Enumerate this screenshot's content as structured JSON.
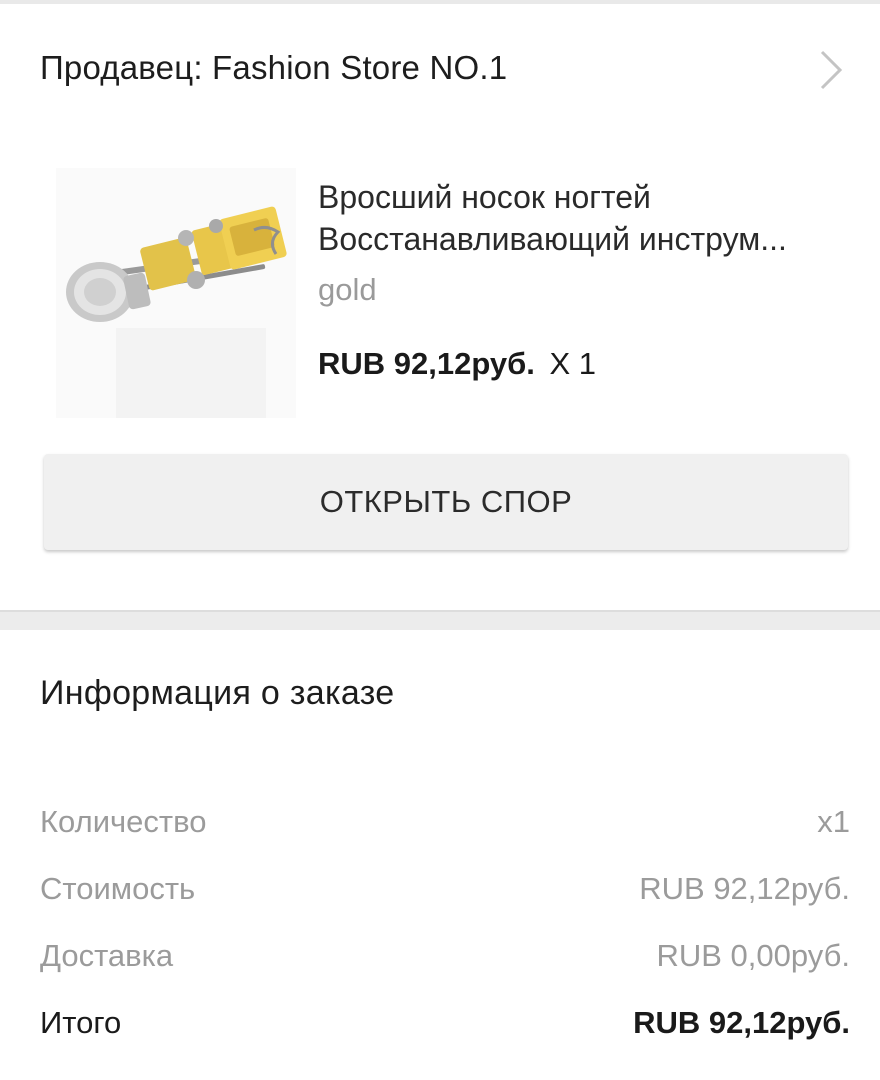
{
  "seller": {
    "label": "Продавец: Fashion Store NO.1"
  },
  "product": {
    "title_line1": "Вросший носок ногтей",
    "title_line2": "Восстанавливающий инструм...",
    "variant": "gold",
    "price": "RUB 92,12руб.",
    "quantity": "X 1"
  },
  "dispute": {
    "button_label": "ОТКРЫТЬ СПОР"
  },
  "order_info": {
    "title": "Информация о заказе",
    "rows": [
      {
        "label": "Количество",
        "value": "x1"
      },
      {
        "label": "Стоимость",
        "value": "RUB 92,12руб."
      },
      {
        "label": "Доставка",
        "value": "RUB 0,00руб."
      },
      {
        "label": "Итого",
        "value": "RUB 92,12руб."
      }
    ]
  },
  "icons": {
    "chevron": "chevron-right-icon"
  },
  "colors": {
    "muted_text": "#9b9b9b",
    "button_bg": "#f0f0f0",
    "section_gap": "#ececec"
  }
}
